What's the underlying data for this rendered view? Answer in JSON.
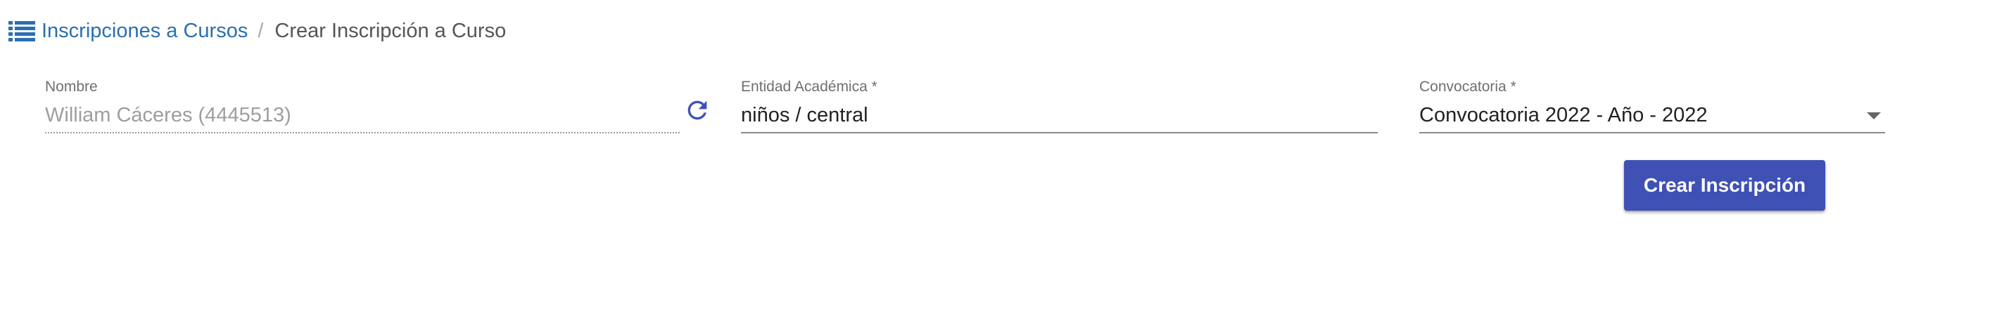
{
  "breadcrumb": {
    "parent_label": "Inscripciones a Cursos",
    "separator": "/",
    "current_label": "Crear Inscripción a Curso",
    "icon": "list-icon",
    "link_color": "#2a6fb0"
  },
  "form": {
    "nombre": {
      "label": "Nombre",
      "value": "William Cáceres (4445513)"
    },
    "refresh": {
      "icon": "refresh-icon",
      "color": "#3f51b5"
    },
    "entidad": {
      "label": "Entidad Académica *",
      "value": "niños / central"
    },
    "convocatoria": {
      "label": "Convocatoria *",
      "value": "Convocatoria 2022 - Año - 2022",
      "icon": "dropdown-caret-icon"
    },
    "submit": {
      "label": "Crear Inscripción",
      "color": "#3f51b5"
    }
  }
}
